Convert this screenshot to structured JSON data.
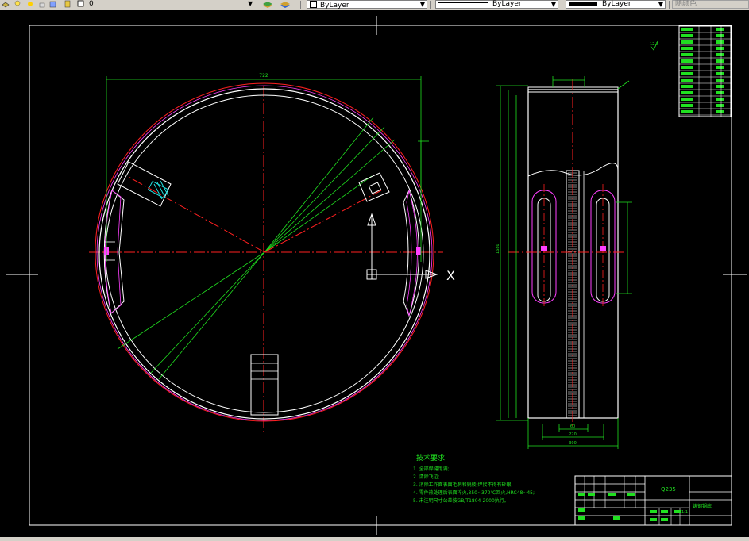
{
  "toolbar": {
    "layer_value": "0",
    "color_value": "ByLayer",
    "linetype_value": "ByLayer",
    "lineweight_value": "ByLayer",
    "plotstyle_value": "随颜色"
  },
  "drawing": {
    "dim_diameter": "722",
    "dim_height_total": "1680",
    "dim_width_bottom": "300",
    "dim_width_mid": "220",
    "dim_width_inner": "60",
    "cursor_label": "X",
    "roughness": "12.5",
    "part_name": "Q235",
    "title_text": "铸钢锅底",
    "scale": "1:1",
    "tech_title": "技术要求",
    "tech_notes": [
      "1. 全部焊缝饱满;",
      "2. 清除飞边;",
      "3. 消除工作面表面毛刺和锐棱,焊接不得有砂眼;",
      "4. 零件热处理后表面淬火,350~370℃回火,HRC48~45;",
      "5. 未注明尺寸公差按GB/T1804-2000执行。"
    ]
  }
}
